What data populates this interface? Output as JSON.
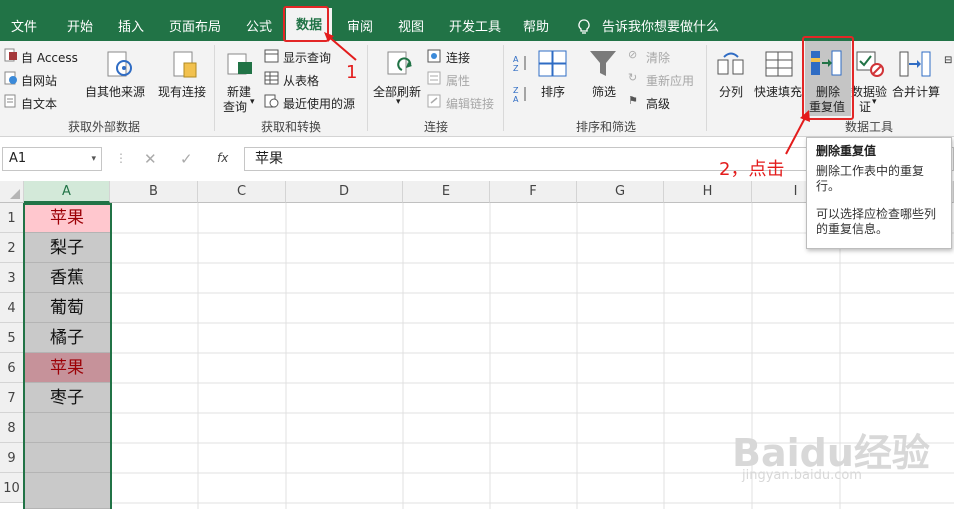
{
  "menu": {
    "tabs": [
      "文件",
      "开始",
      "插入",
      "页面布局",
      "公式",
      "数据",
      "审阅",
      "视图",
      "开发工具",
      "帮助"
    ],
    "active": "数据",
    "tell_me": "告诉我你想要做什么"
  },
  "ribbon": {
    "get_external": {
      "access": "自 Access",
      "web": "自网站",
      "text": "自文本",
      "other": "自其他来源",
      "existing": "现有连接",
      "label": "获取外部数据"
    },
    "get_transform": {
      "new_query_1": "新建",
      "new_query_2": "查询",
      "show_queries": "显示查询",
      "from_table": "从表格",
      "recent_sources": "最近使用的源",
      "label": "获取和转换"
    },
    "connections": {
      "refresh_all": "全部刷新",
      "connections": "连接",
      "properties": "属性",
      "edit_links": "编辑链接",
      "label": "连接"
    },
    "sort_filter": {
      "sort": "排序",
      "filter": "筛选",
      "clear": "清除",
      "reapply": "重新应用",
      "advanced": "高级",
      "label": "排序和筛选"
    },
    "data_tools": {
      "text_to_columns": "分列",
      "flash_fill": "快速填充",
      "remove_dup_1": "删除",
      "remove_dup_2": "重复值",
      "validation_1": "数据验",
      "validation_2": "证",
      "consolidate": "合并计算",
      "label": "数据工具"
    }
  },
  "formula_bar": {
    "name_box": "A1",
    "formula": "苹果"
  },
  "grid": {
    "columns": [
      "A",
      "B",
      "C",
      "D",
      "E",
      "F",
      "G",
      "H",
      "I"
    ],
    "rows": [
      "1",
      "2",
      "3",
      "4",
      "5",
      "6",
      "7",
      "8",
      "9",
      "10"
    ],
    "col_a_values": [
      "苹果",
      "梨子",
      "香蕉",
      "葡萄",
      "橘子",
      "苹果",
      "枣子",
      "",
      "",
      ""
    ]
  },
  "tooltip": {
    "title": "删除重复值",
    "line1": "删除工作表中的重复",
    "line2": "行。",
    "line3": "可以选择应检查哪些列",
    "line4": "的重复信息。"
  },
  "annotations": {
    "step1": "1",
    "step2": "2，点击"
  },
  "watermark": {
    "brand": "Baidu经验",
    "url": "jingyan.baidu.com"
  },
  "colors": {
    "excel_green": "#217346",
    "highlight_pink": "#ffc7ce",
    "highlight_red_text": "#9c0006",
    "annotation_red": "#e31c1c"
  }
}
